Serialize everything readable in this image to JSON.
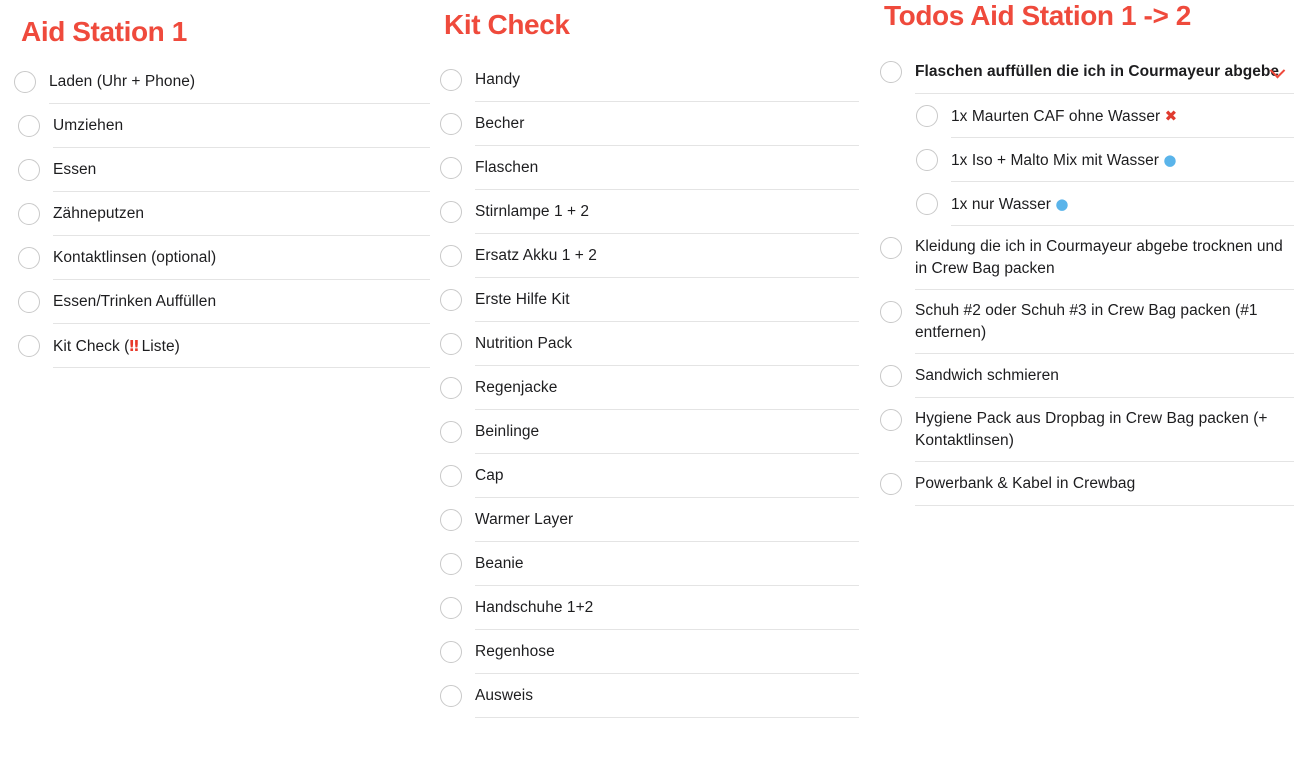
{
  "colors": {
    "title_red": "#ef4a3c",
    "text": "#1d1d1f",
    "separator": "#e4e4e4",
    "checkbox_border": "#c9c9c9",
    "background": "#ffffff"
  },
  "columns": [
    {
      "id": "aid-station-1",
      "title": "Aid Station 1",
      "items": [
        {
          "label": "Laden (Uhr + Phone)",
          "checked": false,
          "bold": false
        },
        {
          "label": "Umziehen",
          "checked": false,
          "bold": false
        },
        {
          "label": "Essen",
          "checked": false,
          "bold": false
        },
        {
          "label": "Zähneputzen",
          "checked": false,
          "bold": false
        },
        {
          "label": "Kontaktlinsen (optional)",
          "checked": false,
          "bold": false
        },
        {
          "label": "Essen/Trinken Auffüllen",
          "checked": false,
          "bold": false
        },
        {
          "label": "Kit Check (‼️ Liste)",
          "checked": false,
          "bold": false,
          "emoji": "double-exclamation"
        }
      ]
    },
    {
      "id": "kit-check",
      "title": "Kit Check",
      "items": [
        {
          "label": "Handy",
          "checked": false,
          "bold": false
        },
        {
          "label": "Becher",
          "checked": false,
          "bold": false
        },
        {
          "label": "Flaschen",
          "checked": false,
          "bold": false
        },
        {
          "label": "Stirnlampe 1 + 2",
          "checked": false,
          "bold": false
        },
        {
          "label": "Ersatz Akku 1 + 2",
          "checked": false,
          "bold": false
        },
        {
          "label": "Erste Hilfe Kit",
          "checked": false,
          "bold": false
        },
        {
          "label": "Nutrition Pack",
          "checked": false,
          "bold": false
        },
        {
          "label": "Regenjacke",
          "checked": false,
          "bold": false
        },
        {
          "label": "Beinlinge",
          "checked": false,
          "bold": false
        },
        {
          "label": "Cap",
          "checked": false,
          "bold": false
        },
        {
          "label": "Warmer Layer",
          "checked": false,
          "bold": false
        },
        {
          "label": "Beanie",
          "checked": false,
          "bold": false
        },
        {
          "label": "Handschuhe 1+2",
          "checked": false,
          "bold": false
        },
        {
          "label": "Regenhose",
          "checked": false,
          "bold": false
        },
        {
          "label": "Ausweis",
          "checked": false,
          "bold": false
        }
      ]
    },
    {
      "id": "todos-aid-station-1-to-2",
      "title": "Todos Aid Station 1 -> 2",
      "items": [
        {
          "label": "Flaschen auffüllen die ich in Courmayeur abgebe",
          "checked": false,
          "bold": true,
          "expandable": true,
          "expanded": true,
          "chevron": "chevron-down-icon"
        },
        {
          "label": "1x Maurten CAF ohne Wasser ❌",
          "checked": false,
          "bold": false,
          "sub": true,
          "emoji": "cross-mark"
        },
        {
          "label": "1x Iso + Malto Mix mit Wasser 💧",
          "checked": false,
          "bold": false,
          "sub": true,
          "emoji": "droplet"
        },
        {
          "label": "1x nur Wasser 💧",
          "checked": false,
          "bold": false,
          "sub": true,
          "emoji": "droplet"
        },
        {
          "label": "Kleidung die ich in Courmayeur abgebe trocknen und in Crew Bag packen",
          "checked": false,
          "bold": false
        },
        {
          "label": "Schuh #2 oder Schuh #3 in Crew Bag packen (#1 entfernen)",
          "checked": false,
          "bold": false
        },
        {
          "label": "Sandwich schmieren",
          "checked": false,
          "bold": false
        },
        {
          "label": "Hygiene Pack aus Dropbag in Crew Bag packen (+ Kontaktlinsen)",
          "checked": false,
          "bold": false
        },
        {
          "label": "Powerbank & Kabel in Crewbag",
          "checked": false,
          "bold": false
        }
      ]
    }
  ]
}
